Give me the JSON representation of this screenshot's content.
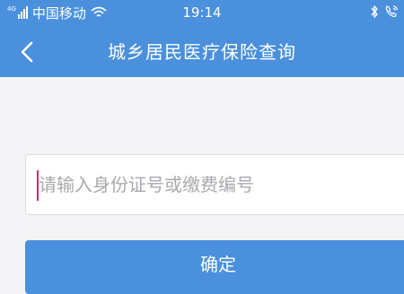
{
  "status_bar": {
    "network_type": "4G",
    "carrier": "中国移动",
    "time": "19:14"
  },
  "nav": {
    "title": "城乡居民医疗保险查询"
  },
  "form": {
    "id_input": {
      "placeholder": "请输入身份证号或缴费编号",
      "value": ""
    },
    "confirm_label": "确定"
  },
  "colors": {
    "primary": "#4a90dc",
    "background": "#f4f4f6",
    "caret": "#d12b6b",
    "placeholder": "#a9a9ae"
  },
  "icons": [
    "signal-icon",
    "wifi-icon",
    "bluetooth-icon",
    "phone-icon",
    "back-arrow-icon"
  ]
}
